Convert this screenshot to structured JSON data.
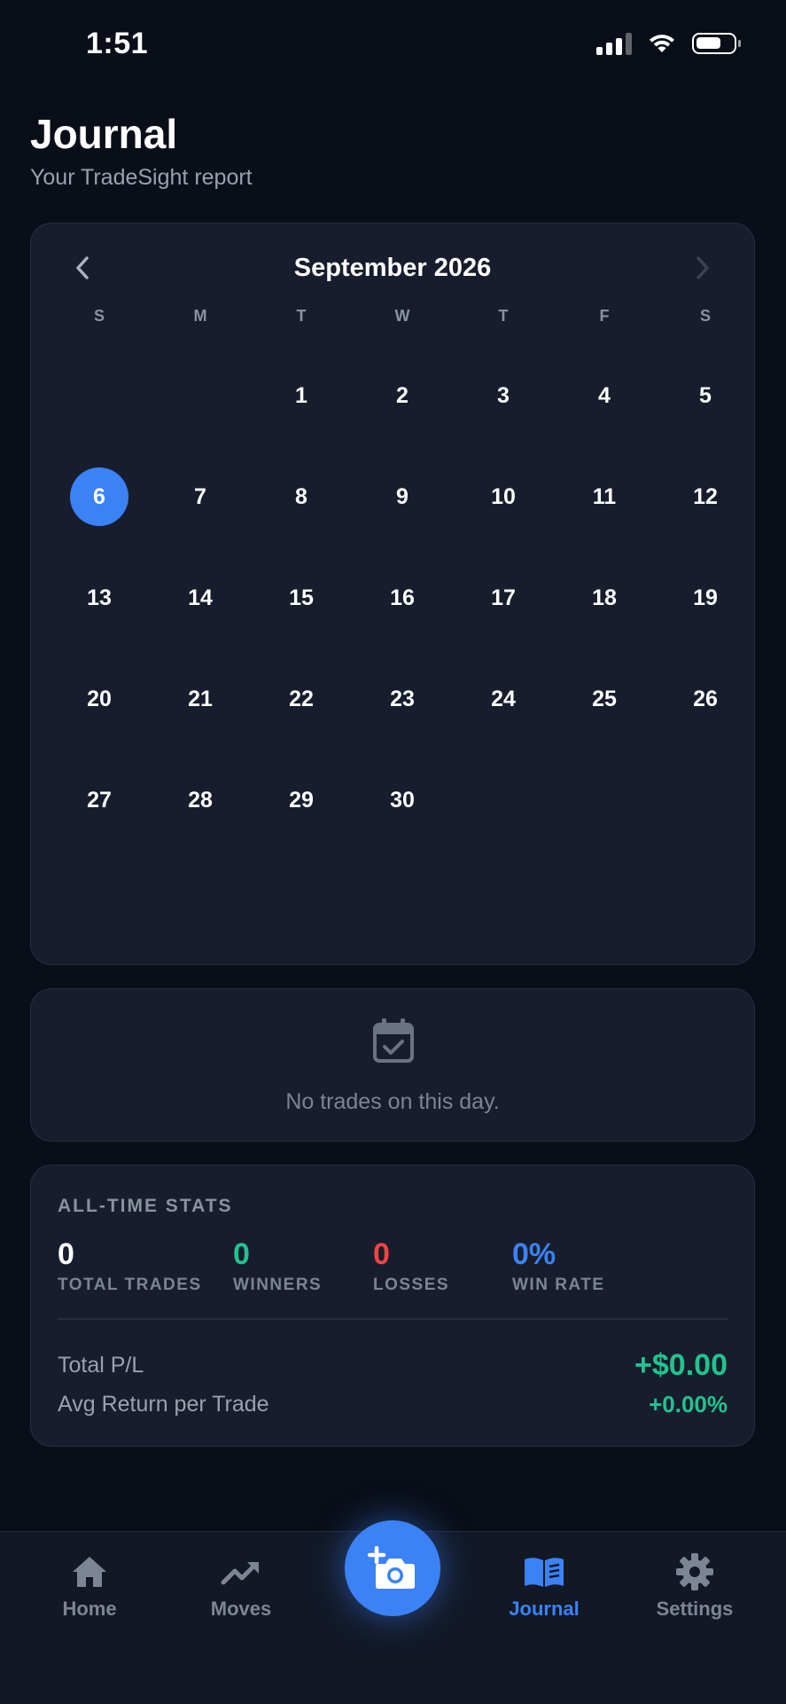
{
  "status_bar": {
    "time": "1:51"
  },
  "header": {
    "title": "Journal",
    "subtitle": "Your TradeSight report"
  },
  "calendar": {
    "month_label": "September 2026",
    "weekdays": [
      "S",
      "M",
      "T",
      "W",
      "T",
      "F",
      "S"
    ],
    "leading_blanks": 2,
    "days": [
      "1",
      "2",
      "3",
      "4",
      "5",
      "6",
      "7",
      "8",
      "9",
      "10",
      "11",
      "12",
      "13",
      "14",
      "15",
      "16",
      "17",
      "18",
      "19",
      "20",
      "21",
      "22",
      "23",
      "24",
      "25",
      "26",
      "27",
      "28",
      "29",
      "30"
    ],
    "selected_day": "6",
    "accent_color": "#3b82f6"
  },
  "day_detail": {
    "icon": "calendar-check-icon",
    "empty_message": "No trades on this day."
  },
  "stats": {
    "heading": "ALL-TIME STATS",
    "total_trades": {
      "value": "0",
      "label": "TOTAL TRADES"
    },
    "winners": {
      "value": "0",
      "label": "WINNERS",
      "color": "#22c38e"
    },
    "losses": {
      "value": "0",
      "label": "LOSSES",
      "color": "#ef4444"
    },
    "win_rate": {
      "value": "0%",
      "label": "WIN RATE",
      "color": "#3b82f6"
    },
    "total_pl": {
      "label": "Total P/L",
      "value": "+$0.00"
    },
    "avg_return": {
      "label": "Avg Return per Trade",
      "value": "+0.00%"
    }
  },
  "tabs": [
    {
      "label": "Home",
      "icon": "home-icon"
    },
    {
      "label": "Moves",
      "icon": "trending-up-icon"
    },
    {
      "label": "Journal",
      "icon": "book-icon",
      "active": true
    },
    {
      "label": "Settings",
      "icon": "gear-icon"
    }
  ],
  "fab": {
    "icon": "add-photo-icon"
  }
}
